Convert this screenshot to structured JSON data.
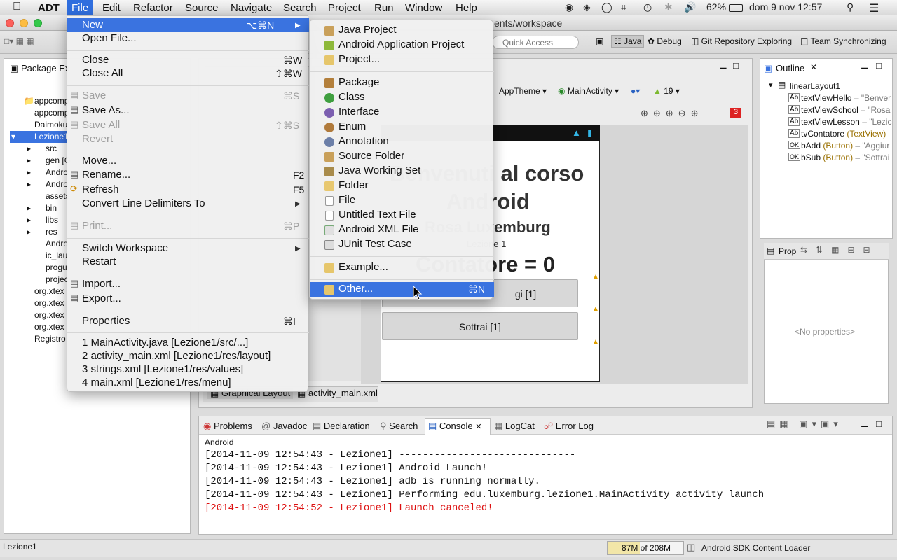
{
  "menubar": {
    "app": "ADT",
    "items": [
      "File",
      "Edit",
      "Refactor",
      "Source",
      "Navigate",
      "Search",
      "Project",
      "Run",
      "Window",
      "Help"
    ],
    "battery": "62%",
    "clock": "dom 9 nov  12:57"
  },
  "window": {
    "title": "ents/workspace"
  },
  "toolbar": {
    "quick_access": "Quick Access",
    "perspectives": [
      "Java",
      "Debug",
      "Git Repository Exploring",
      "Team Synchronizing"
    ]
  },
  "package_explorer": {
    "title": "Package Ex",
    "items": [
      "appcomp",
      "appcomp",
      "Daimoku",
      "Lezione1",
      "src",
      "gen [G",
      "Andro",
      "Andro",
      "assets",
      "bin",
      "libs",
      "res",
      "Andro",
      "ic_lau",
      "progu",
      "projec",
      "org.xtex",
      "org.xtex",
      "org.xtex",
      "org.xtex",
      "Registro"
    ]
  },
  "editor": {
    "theme": "AppTheme",
    "activity": "MainActivity",
    "api": "19",
    "error_count": "3",
    "tabs": [
      "Graphical Layout",
      "activity_main.xml"
    ],
    "device": {
      "line1": "Benvenuti al corso",
      "line2": "Android",
      "line3": "Rosa Luxemburg",
      "line4": "Lezione 1",
      "counter": "Contatore = 0",
      "add_button": "Aggiungi [1]",
      "add_visible": "gi [1]",
      "sub_button": "Sottrai [1]"
    }
  },
  "outline": {
    "title": "Outline",
    "root": "linearLayout1",
    "items": [
      {
        "name": "textViewHello",
        "type": "",
        "extra": "– \"Benver"
      },
      {
        "name": "textViewSchool",
        "type": "",
        "extra": "– \"Rosa"
      },
      {
        "name": "textViewLesson",
        "type": "",
        "extra": "– \"Lezic"
      },
      {
        "name": "tvContatore",
        "type": "(TextView)",
        "extra": ""
      },
      {
        "name": "bAdd",
        "type": "(Button)",
        "extra": "– \"Aggiur"
      },
      {
        "name": "bSub",
        "type": "(Button)",
        "extra": "– \"Sottrai"
      }
    ]
  },
  "properties": {
    "title": "Prop",
    "empty": "<No properties>"
  },
  "bottom_tabs": [
    "Problems",
    "Javadoc",
    "Declaration",
    "Search",
    "Console",
    "LogCat",
    "Error Log"
  ],
  "console": {
    "label": "Android",
    "lines": [
      "[2014-11-09 12:54:43 - Lezione1] ------------------------------",
      "[2014-11-09 12:54:43 - Lezione1] Android Launch!",
      "[2014-11-09 12:54:43 - Lezione1] adb is running normally.",
      "[2014-11-09 12:54:43 - Lezione1] Performing edu.luxemburg.lezione1.MainActivity activity launch",
      "[2014-11-09 12:54:52 - Lezione1] Launch canceled!"
    ]
  },
  "status": {
    "left": "Lezione1",
    "memory": "87M of 208M",
    "loader": "Android SDK Content Loader"
  },
  "file_menu": {
    "new": {
      "label": "New",
      "shortcut": "⌥⌘N"
    },
    "open_file": "Open File...",
    "close": {
      "label": "Close",
      "shortcut": "⌘W"
    },
    "close_all": {
      "label": "Close All",
      "shortcut": "⇧⌘W"
    },
    "save": {
      "label": "Save",
      "shortcut": "⌘S"
    },
    "save_as": "Save As...",
    "save_all": {
      "label": "Save All",
      "shortcut": "⇧⌘S"
    },
    "revert": "Revert",
    "move": "Move...",
    "rename": {
      "label": "Rename...",
      "shortcut": "F2"
    },
    "refresh": {
      "label": "Refresh",
      "shortcut": "F5"
    },
    "convert": "Convert Line Delimiters To",
    "print": {
      "label": "Print...",
      "shortcut": "⌘P"
    },
    "switch_workspace": "Switch Workspace",
    "restart": "Restart",
    "import": "Import...",
    "export": "Export...",
    "properties": {
      "label": "Properties",
      "shortcut": "⌘I"
    },
    "recent": [
      "1 MainActivity.java  [Lezione1/src/...]",
      "2 activity_main.xml  [Lezione1/res/layout]",
      "3 strings.xml  [Lezione1/res/values]",
      "4 main.xml  [Lezione1/res/menu]"
    ]
  },
  "new_submenu": {
    "items": [
      "Java Project",
      "Android Application Project",
      "Project...",
      "Package",
      "Class",
      "Interface",
      "Enum",
      "Annotation",
      "Source Folder",
      "Java Working Set",
      "Folder",
      "File",
      "Untitled Text File",
      "Android XML File",
      "JUnit Test Case",
      "Example...",
      "Other..."
    ],
    "other_shortcut": "⌘N"
  },
  "colors": {
    "menu_highlight": "#3a73e0",
    "error_text": "#dd1111"
  }
}
